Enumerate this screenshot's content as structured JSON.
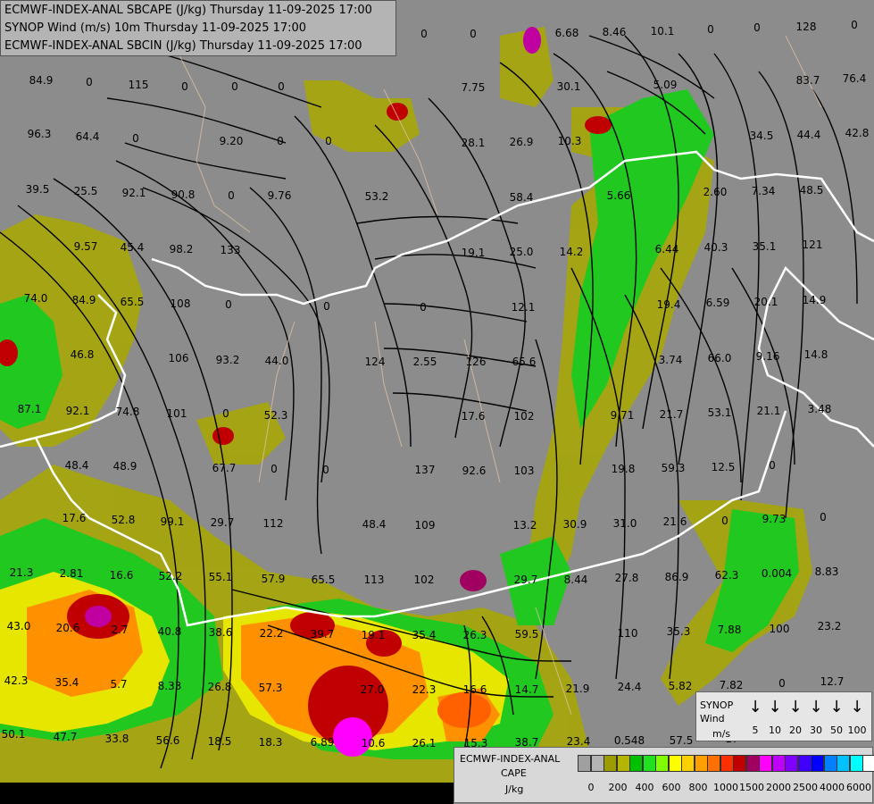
{
  "header": {
    "line1": "ECMWF-INDEX-ANAL SBCAPE (J/kg) Thursday 11-09-2025 17:00",
    "line2": "SYNOP Wind (m/s) 10m Thursday 11-09-2025 17:00",
    "line3": "ECMWF-INDEX-ANAL SBCIN (J/kg) Thursday 11-09-2025 17:00"
  },
  "station_values": [
    {
      "label": "84.9"
    },
    {
      "label": "0"
    },
    {
      "label": "115"
    },
    {
      "label": "0"
    },
    {
      "label": "0"
    },
    {
      "label": "0"
    },
    {
      "label": "0"
    },
    {
      "label": "0"
    },
    {
      "label": "6.68"
    },
    {
      "label": "8.46"
    },
    {
      "label": "10.1"
    },
    {
      "label": "0"
    },
    {
      "label": "0"
    },
    {
      "label": "128"
    },
    {
      "label": "0"
    },
    {
      "label": "83.7"
    },
    {
      "label": "76.4"
    },
    {
      "label": "96.3"
    },
    {
      "label": "64.4"
    },
    {
      "label": "0"
    },
    {
      "label": "9.20"
    },
    {
      "label": "0"
    },
    {
      "label": "0"
    },
    {
      "label": "7.75"
    },
    {
      "label": "30.1"
    },
    {
      "label": "5.09"
    },
    {
      "label": "34.5"
    },
    {
      "label": "44.4"
    },
    {
      "label": "42.8"
    },
    {
      "label": "28.1"
    },
    {
      "label": "26.9"
    },
    {
      "label": "10.3"
    },
    {
      "label": "39.5"
    },
    {
      "label": "25.5"
    },
    {
      "label": "92.1"
    },
    {
      "label": "90.8"
    },
    {
      "label": "0"
    },
    {
      "label": "9.76"
    },
    {
      "label": "53.2"
    },
    {
      "label": "58.4"
    },
    {
      "label": "5.66"
    },
    {
      "label": "2.60"
    },
    {
      "label": "7.34"
    },
    {
      "label": "48.5"
    },
    {
      "label": "9.57"
    },
    {
      "label": "45.4"
    },
    {
      "label": "98.2"
    },
    {
      "label": "133"
    },
    {
      "label": "19.1"
    },
    {
      "label": "25.0"
    },
    {
      "label": "14.2"
    },
    {
      "label": "6.44"
    },
    {
      "label": "40.3"
    },
    {
      "label": "35.1"
    },
    {
      "label": "121"
    },
    {
      "label": "74.0"
    },
    {
      "label": "84.9"
    },
    {
      "label": "65.5"
    },
    {
      "label": "108"
    },
    {
      "label": "0"
    },
    {
      "label": "0"
    },
    {
      "label": "0"
    },
    {
      "label": "12.1"
    },
    {
      "label": "19.4"
    },
    {
      "label": "6.59"
    },
    {
      "label": "20.1"
    },
    {
      "label": "14.9"
    },
    {
      "label": "46.8"
    },
    {
      "label": "106"
    },
    {
      "label": "93.2"
    },
    {
      "label": "44.0"
    },
    {
      "label": "124"
    },
    {
      "label": "2.55"
    },
    {
      "label": "126"
    },
    {
      "label": "65.6"
    },
    {
      "label": "3.74"
    },
    {
      "label": "66.0"
    },
    {
      "label": "9.16"
    },
    {
      "label": "14.8"
    },
    {
      "label": "87.1"
    },
    {
      "label": "92.1"
    },
    {
      "label": "74.8"
    },
    {
      "label": "101"
    },
    {
      "label": "0"
    },
    {
      "label": "52.3"
    },
    {
      "label": "17.6"
    },
    {
      "label": "102"
    },
    {
      "label": "9.71"
    },
    {
      "label": "21.7"
    },
    {
      "label": "53.1"
    },
    {
      "label": "21.1"
    },
    {
      "label": "3.48"
    },
    {
      "label": "48.4"
    },
    {
      "label": "48.9"
    },
    {
      "label": "67.7"
    },
    {
      "label": "0"
    },
    {
      "label": "137"
    },
    {
      "label": "92.6"
    },
    {
      "label": "103"
    },
    {
      "label": "19.8"
    },
    {
      "label": "59.3"
    },
    {
      "label": "12.5"
    },
    {
      "label": "0"
    },
    {
      "label": "0"
    },
    {
      "label": "17.6"
    },
    {
      "label": "52.8"
    },
    {
      "label": "99.1"
    },
    {
      "label": "29.7"
    },
    {
      "label": "112"
    },
    {
      "label": "48.4"
    },
    {
      "label": "109"
    },
    {
      "label": "13.2"
    },
    {
      "label": "30.9"
    },
    {
      "label": "31.0"
    },
    {
      "label": "21.6"
    },
    {
      "label": "0"
    },
    {
      "label": "9.73"
    },
    {
      "label": "0"
    },
    {
      "label": "21.3"
    },
    {
      "label": "2.81"
    },
    {
      "label": "16.6"
    },
    {
      "label": "52.2"
    },
    {
      "label": "55.1"
    },
    {
      "label": "57.9"
    },
    {
      "label": "65.5"
    },
    {
      "label": "113"
    },
    {
      "label": "102"
    },
    {
      "label": "29.7"
    },
    {
      "label": "8.44"
    },
    {
      "label": "27.8"
    },
    {
      "label": "86.9"
    },
    {
      "label": "62.3"
    },
    {
      "label": "0.004"
    },
    {
      "label": "8.83"
    },
    {
      "label": "43.0"
    },
    {
      "label": "20.6"
    },
    {
      "label": "2.7"
    },
    {
      "label": "40.8"
    },
    {
      "label": "38.6"
    },
    {
      "label": "22.2"
    },
    {
      "label": "39.7"
    },
    {
      "label": "19.1"
    },
    {
      "label": "35.4"
    },
    {
      "label": "26.3"
    },
    {
      "label": "59.5"
    },
    {
      "label": "110"
    },
    {
      "label": "35.3"
    },
    {
      "label": "7.88"
    },
    {
      "label": "100"
    },
    {
      "label": "23.2"
    },
    {
      "label": "42.3"
    },
    {
      "label": "35.4"
    },
    {
      "label": "5.7"
    },
    {
      "label": "8.33"
    },
    {
      "label": "26.8"
    },
    {
      "label": "57.3"
    },
    {
      "label": "27.0"
    },
    {
      "label": "22.3"
    },
    {
      "label": "16.6"
    },
    {
      "label": "14.7"
    },
    {
      "label": "21.9"
    },
    {
      "label": "24.4"
    },
    {
      "label": "5.82"
    },
    {
      "label": "7.82"
    },
    {
      "label": "0"
    },
    {
      "label": "12.7"
    },
    {
      "label": "50.1"
    },
    {
      "label": "47.7"
    },
    {
      "label": "33.8"
    },
    {
      "label": "56.6"
    },
    {
      "label": "18.5"
    },
    {
      "label": "18.3"
    },
    {
      "label": "6.89"
    },
    {
      "label": "10.6"
    },
    {
      "label": "26.1"
    },
    {
      "label": "15.3"
    },
    {
      "label": "38.7"
    },
    {
      "label": "23.4"
    },
    {
      "label": "0.548"
    },
    {
      "label": "57.5"
    },
    {
      "label": "17"
    },
    {
      "label": "0"
    }
  ],
  "synop_legend": {
    "title_line1": "SYNOP",
    "title_line2": "Wind",
    "title_line3": "m/s",
    "values": [
      "5",
      "10",
      "20",
      "30",
      "50",
      "100"
    ]
  },
  "cape_legend": {
    "title_line1": "ECMWF-INDEX-ANAL",
    "title_line2": "CAPE",
    "title_line3": "J/kg",
    "colors": [
      "#a0a0a0",
      "#b4b4b4",
      "#9c9c00",
      "#b5b500",
      "#00c000",
      "#20e020",
      "#80ff00",
      "#ffff00",
      "#ffd000",
      "#ffa000",
      "#ff7000",
      "#ff3000",
      "#c00000",
      "#a00060",
      "#ff00ff",
      "#c000ff",
      "#8000ff",
      "#4000ff",
      "#0000ff",
      "#0080ff",
      "#00c0ff",
      "#00ffff",
      "#ffffff"
    ],
    "ticks": [
      "0",
      "200",
      "400",
      "600",
      "800",
      "1000",
      "1500",
      "2000",
      "2500",
      "4000",
      "6000"
    ]
  }
}
